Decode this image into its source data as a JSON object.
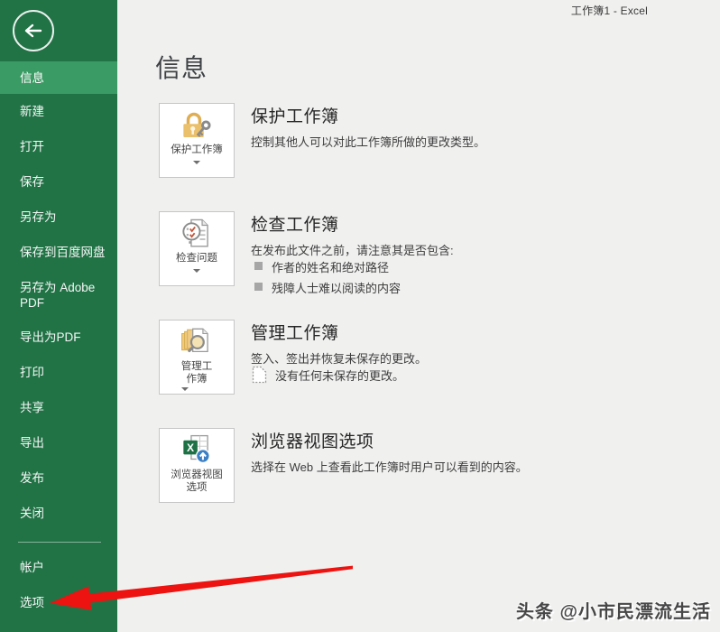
{
  "window": {
    "title": "工作簿1 - Excel"
  },
  "sidebar": {
    "items": [
      {
        "label": "信息",
        "selected": true
      },
      {
        "label": "新建"
      },
      {
        "label": "打开"
      },
      {
        "label": "保存"
      },
      {
        "label": "另存为"
      },
      {
        "label": "保存到百度网盘"
      },
      {
        "label": "另存为 Adobe PDF"
      },
      {
        "label": "导出为PDF"
      },
      {
        "label": "打印"
      },
      {
        "label": "共享"
      },
      {
        "label": "导出"
      },
      {
        "label": "发布"
      },
      {
        "label": "关闭"
      },
      {
        "label": "帐户"
      },
      {
        "label": "选项"
      }
    ],
    "back_icon": "back-arrow-icon"
  },
  "main": {
    "title": "信息",
    "sections": [
      {
        "button_lines": [
          "保护工作簿"
        ],
        "heading": "保护工作簿",
        "desc": "控制其他人可以对此工作簿所做的更改类型。",
        "icon": "lock-key-icon"
      },
      {
        "button_lines": [
          "检查问题"
        ],
        "heading": "检查工作簿",
        "desc": "在发布此文件之前，请注意其是否包含:",
        "bullets": [
          "作者的姓名和绝对路径",
          "残障人士难以阅读的内容"
        ],
        "icon": "inspect-document-icon"
      },
      {
        "button_lines": [
          "管理工",
          "作簿"
        ],
        "heading": "管理工作簿",
        "desc": "签入、签出并恢复未保存的更改。",
        "status": "没有任何未保存的更改。",
        "icon": "manage-versions-icon"
      },
      {
        "button_lines": [
          "浏览器视图",
          "选项"
        ],
        "heading": "浏览器视图选项",
        "desc": "选择在 Web 上查看此工作簿时用户可以看到的内容。",
        "icon": "browser-view-icon"
      }
    ]
  },
  "watermark": "头条 @小市民漂流生活",
  "colors": {
    "sidebar_green": "#217346",
    "selected_green": "#3b9b64",
    "arrow_red": "#ec1310",
    "excel_green": "#1e7145",
    "accent_blue": "#3b7fc4",
    "lock_gold": "#ebc06c",
    "main_background": "#f0f0ef"
  }
}
